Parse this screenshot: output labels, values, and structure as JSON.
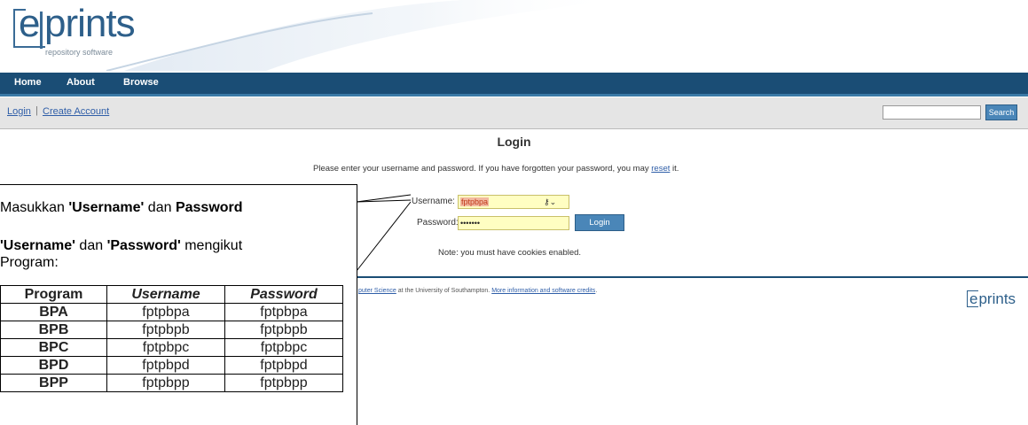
{
  "header": {
    "logo": {
      "brand": "eprints",
      "tagline": "repository software"
    },
    "nav": [
      "Home",
      "About",
      "Browse"
    ]
  },
  "subbar": {
    "links": [
      "Login",
      "Create Account"
    ],
    "separator": "|",
    "search_value": "",
    "search_button": "Search"
  },
  "login": {
    "title": "Login",
    "intro_before": "Please enter your username and password. If you have forgotten your password, you may ",
    "intro_link": "reset",
    "intro_after": " it.",
    "username_label": "Username:",
    "username_value": "fptpbpa",
    "password_label": "Password:",
    "password_value": "•••••••",
    "button": "Login",
    "note": "Note: you must have cookies enabled."
  },
  "footer": {
    "text_before": "puter Science",
    "text_mid": " at the University of Southampton. ",
    "text_link": "More information and software credits",
    "text_after": ".",
    "logo": "eprints"
  },
  "annotation": {
    "line1_a": "Masukkan ",
    "line1_b": "'Username'",
    "line1_c": " dan ",
    "line1_d": "Password",
    "line2_a": "'Username'",
    "line2_b": " dan ",
    "line2_c": "'Password'",
    "line2_d": " mengikut",
    "line3": "Program:",
    "table": {
      "headers": [
        "Program",
        "Username",
        "Password"
      ],
      "rows": [
        [
          "BPA",
          "fptpbpa",
          "fptpbpa"
        ],
        [
          "BPB",
          "fptpbpb",
          "fptpbpb"
        ],
        [
          "BPC",
          "fptpbpc",
          "fptpbpc"
        ],
        [
          "BPD",
          "fptpbpd",
          "fptpbpd"
        ],
        [
          "BPP",
          "fptpbpp",
          "fptpbpp"
        ]
      ]
    }
  },
  "colors": {
    "nav_bg": "#1a4d75",
    "link": "#2f5ea8",
    "field_bg": "#fffec2",
    "button_bg": "#4a86b8"
  }
}
